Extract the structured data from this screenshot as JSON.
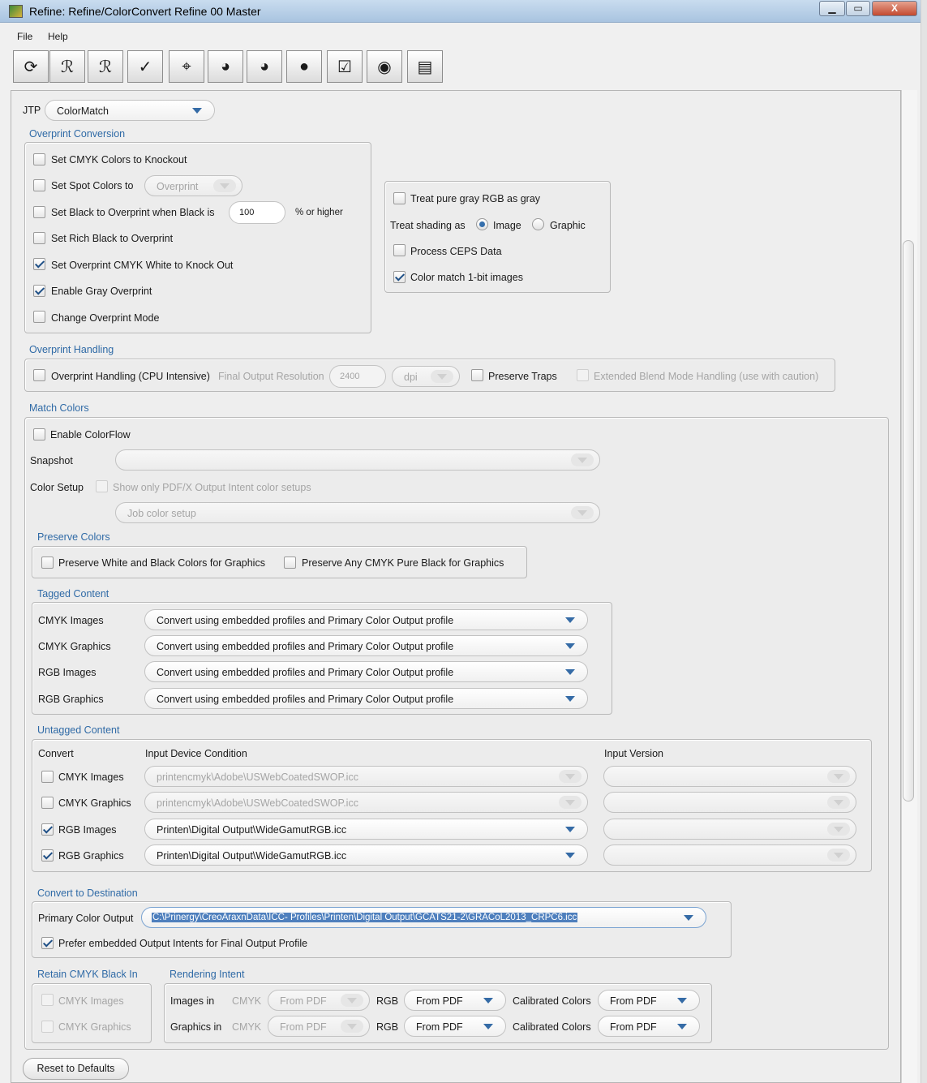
{
  "window": {
    "title": "Refine: Refine/ColorConvert Refine 00 Master",
    "minimize": "▁",
    "maximize": "▭",
    "close": "X"
  },
  "menu": {
    "file": "File",
    "help": "Help"
  },
  "toolbar": [
    {
      "icon": "refresh-icon",
      "glyph": "⟳"
    },
    {
      "icon": "pdf-acrobat-icon",
      "glyph": "ℛ"
    },
    {
      "icon": "pdf-acrobat-alt-icon",
      "glyph": "ℛ"
    },
    {
      "icon": "checkmark-tool-icon",
      "glyph": "✓"
    },
    {
      "icon": "crosshair-icon",
      "glyph": "⌖"
    },
    {
      "icon": "color-wheel-icon",
      "glyph": "◕"
    },
    {
      "icon": "color-wheel-alt-icon",
      "glyph": "◕"
    },
    {
      "icon": "gray-circle-icon",
      "glyph": "●"
    },
    {
      "icon": "checklist-icon",
      "glyph": "☑"
    },
    {
      "icon": "red-dot-icon",
      "glyph": "◉"
    },
    {
      "icon": "report-icon",
      "glyph": "▤"
    }
  ],
  "jtp": {
    "label": "JTP",
    "value": "ColorMatch"
  },
  "overprint_conversion": {
    "title": "Overprint Conversion",
    "set_cmyk_knockout": "Set CMYK Colors to Knockout",
    "set_spot_colors": "Set Spot Colors to",
    "spot_value": "Overprint",
    "set_black_overprint": "Set Black to Overprint when Black is",
    "black_value": "100",
    "or_higher": "% or higher",
    "set_rich_black": "Set Rich Black to Overprint",
    "set_white_knockout": "Set Overprint CMYK White to Knock Out",
    "enable_gray_overprint": "Enable Gray Overprint",
    "change_overprint_mode": "Change Overprint Mode"
  },
  "gray_panel": {
    "treat_gray": "Treat pure gray RGB as gray",
    "treat_shading": "Treat shading as",
    "image": "Image",
    "graphic": "Graphic",
    "process_ceps": "Process CEPS Data",
    "color_match_1bit": "Color match 1-bit images"
  },
  "overprint_handling": {
    "title": "Overprint Handling",
    "handling": "Overprint Handling (CPU Intensive)",
    "final_res": "Final Output Resolution",
    "res_value": "2400",
    "unit": "dpi",
    "preserve_traps": "Preserve Traps",
    "extended_blend": "Extended Blend Mode Handling (use with caution)"
  },
  "match_colors": {
    "title": "Match Colors",
    "enable_colorflow": "Enable ColorFlow",
    "snapshot": "Snapshot",
    "color_setup": "Color Setup",
    "show_only_pdfx": "Show only PDF/X Output Intent color setups",
    "job_color_setup": "Job color setup"
  },
  "preserve_colors": {
    "title": "Preserve Colors",
    "white_black": "Preserve White and Black Colors for Graphics",
    "pure_black": "Preserve Any CMYK Pure Black for Graphics"
  },
  "tagged_content": {
    "title": "Tagged Content",
    "rows": [
      {
        "label": "CMYK Images",
        "value": "Convert using embedded profiles and Primary Color Output profile"
      },
      {
        "label": "CMYK Graphics",
        "value": "Convert using embedded profiles and Primary Color Output profile"
      },
      {
        "label": "RGB Images",
        "value": "Convert using embedded profiles and Primary Color Output profile"
      },
      {
        "label": "RGB Graphics",
        "value": "Convert using embedded profiles and Primary Color Output profile"
      }
    ]
  },
  "untagged_content": {
    "title": "Untagged Content",
    "col_convert": "Convert",
    "col_input_device": "Input Device Condition",
    "col_input_version": "Input Version",
    "rows": [
      {
        "label": "CMYK Images",
        "device": "printencmyk\\Adobe\\USWebCoatedSWOP.icc",
        "checked": false
      },
      {
        "label": "CMYK Graphics",
        "device": "printencmyk\\Adobe\\USWebCoatedSWOP.icc",
        "checked": false
      },
      {
        "label": "RGB Images",
        "device": "Printen\\Digital Output\\WideGamutRGB.icc",
        "checked": true
      },
      {
        "label": "RGB Graphics",
        "device": "Printen\\Digital Output\\WideGamutRGB.icc",
        "checked": true
      }
    ]
  },
  "convert_destination": {
    "title": "Convert to Destination",
    "primary_label": "Primary Color Output",
    "primary_value": "C:\\Prinergy\\CreoAraxnData\\ICC- Profiles\\Printen\\Digital Output\\GCATS21-2\\GRACoL2013_CRPC6.icc",
    "prefer_embedded": "Prefer embedded Output Intents for Final Output Profile"
  },
  "retain_black": {
    "title": "Retain CMYK Black In",
    "images": "CMYK Images",
    "graphics": "CMYK Graphics"
  },
  "rendering_intent": {
    "title": "Rendering Intent",
    "images_in": "Images in",
    "graphics_in": "Graphics in",
    "cmyk": "CMYK",
    "rgb": "RGB",
    "calibrated": "Calibrated Colors",
    "from_pdf": "From PDF"
  },
  "reset": "Reset to Defaults"
}
